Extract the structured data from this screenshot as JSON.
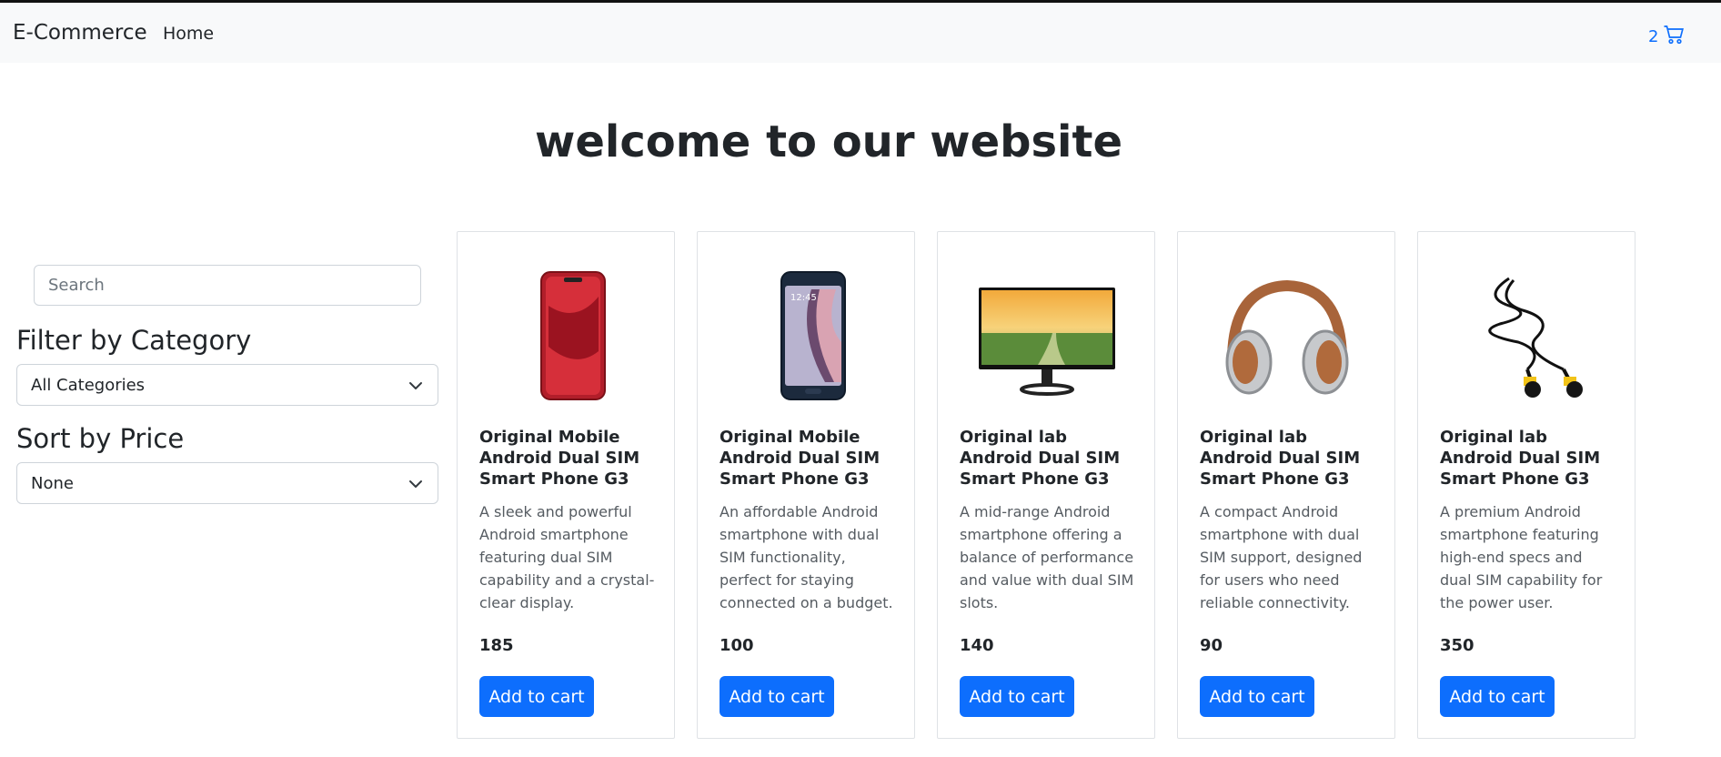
{
  "navbar": {
    "brand": "E-Commerce",
    "home_label": "Home",
    "cart_count": "2",
    "cart_icon": "cart-icon"
  },
  "main": {
    "heading": "welcome to our website"
  },
  "sidebar": {
    "search_placeholder": "Search",
    "filter_title": "Filter by Category",
    "category_selected": "All Categories",
    "sort_title": "Sort by Price",
    "sort_selected": "None"
  },
  "products": [
    {
      "title": "Original Mobile Android Dual SIM Smart Phone G3",
      "description": "A sleek and powerful Android smartphone featuring dual SIM capability and a crystal-clear display.",
      "price": "185",
      "button_label": "Add to cart",
      "image": "red-smartphone-image"
    },
    {
      "title": "Original Mobile Android Dual SIM Smart Phone G3",
      "description": "An affordable Android smartphone with dual SIM functionality, perfect for staying connected on a budget.",
      "price": "100",
      "button_label": "Add to cart",
      "image": "dark-smartphone-image"
    },
    {
      "title": "Original lab Android Dual SIM Smart Phone G3",
      "description": "A mid-range Android smartphone offering a balance of performance and value with dual SIM slots.",
      "price": "140",
      "button_label": "Add to cart",
      "image": "monitor-image"
    },
    {
      "title": "Original lab Android Dual SIM Smart Phone G3",
      "description": "A compact Android smartphone with dual SIM support, designed for users who need reliable connectivity.",
      "price": "90",
      "button_label": "Add to cart",
      "image": "headphones-image"
    },
    {
      "title": "Original lab Android Dual SIM Smart Phone G3",
      "description": "A premium Android smartphone featuring high-end specs and dual SIM capability for the power user.",
      "price": "350",
      "button_label": "Add to cart",
      "image": "earphones-image"
    }
  ],
  "colors": {
    "primary": "#0d6efd",
    "navbar_bg": "#f8f9fa",
    "text": "#212529"
  }
}
